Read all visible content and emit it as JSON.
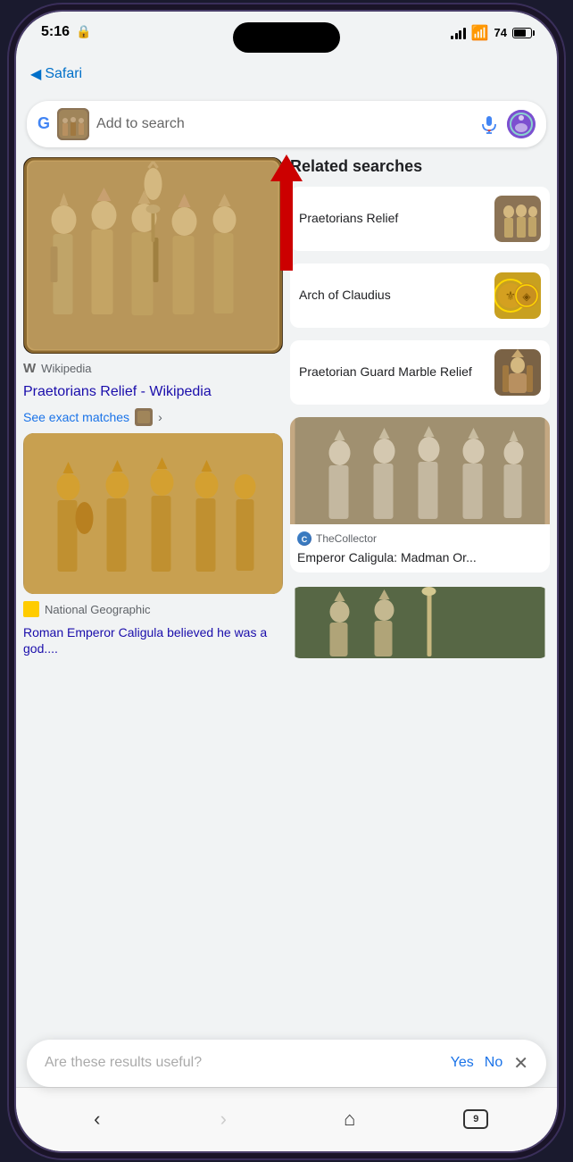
{
  "status_bar": {
    "time": "5:16",
    "battery_level": 74,
    "battery_label": "74"
  },
  "safari": {
    "back_label": "Safari"
  },
  "search_bar": {
    "placeholder": "Add to search",
    "google_logo": "G"
  },
  "related_searches": {
    "title": "Related searches",
    "items": [
      {
        "text": "Praetorians Relief",
        "id": "praetorians-relief"
      },
      {
        "text": "Arch of Claudius",
        "id": "arch-of-claudius"
      },
      {
        "text": "Praetorian Guard Marble Relief",
        "id": "praetorian-guard-marble-relief"
      }
    ]
  },
  "main_results": {
    "left_top": {
      "source": "Wikipedia",
      "title": "Praetorians Relief - Wikipedia",
      "see_exact": "See exact matches"
    },
    "left_bottom": {
      "source": "National Geographic",
      "title": "Roman Emperor Caligula believed he was a god...."
    },
    "right_top": {
      "source": "TheCollector",
      "title": "Emperor Caligula: Madman Or..."
    }
  },
  "feedback": {
    "question": "Are these results useful?",
    "yes_label": "Yes",
    "no_label": "No"
  },
  "browser_nav": {
    "tabs_count": "9"
  }
}
